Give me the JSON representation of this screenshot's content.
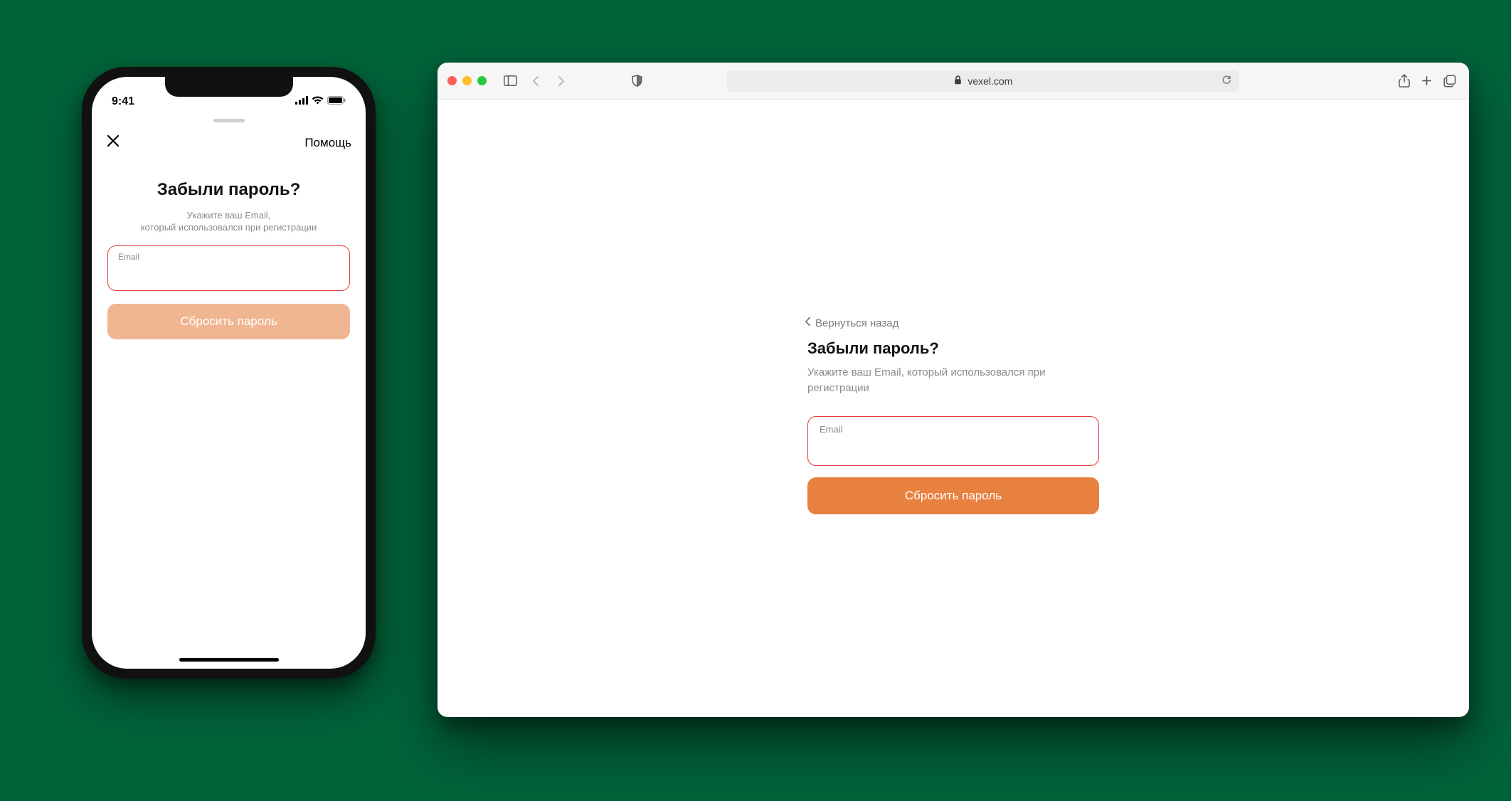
{
  "phone": {
    "status_time": "9:41",
    "help_label": "Помощь",
    "title": "Забыли пароль?",
    "subtitle_line1": "Укажите ваш Email,",
    "subtitle_line2": "который использовался при регистрации",
    "email_label": "Email",
    "email_value": "",
    "reset_button": "Сбросить пароль"
  },
  "browser": {
    "url_host": "vexel.com",
    "back_link": "Вернуться назад",
    "title": "Забыли пароль?",
    "subtitle": "Укажите ваш Email, который использовался при регистрации",
    "email_label": "Email",
    "email_value": "",
    "reset_button": "Сбросить пароль"
  }
}
